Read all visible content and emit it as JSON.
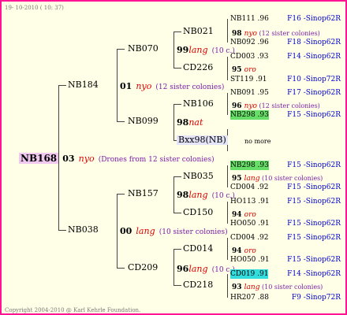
{
  "header": {
    "date": "19- 10-2010 ( 10: 37)"
  },
  "footer": {
    "copyright": "Copyright 2004-2010 @ Karl Kehrle Foundation."
  },
  "root": {
    "id": "NB168",
    "gen": "03",
    "mark": "nyo",
    "note": "(Drones from 12 sister colonies)"
  },
  "g1": {
    "top": "NB184",
    "bot": "NB038"
  },
  "g2a": {
    "num": "01",
    "mark": "nyo",
    "note": "(12 sister colonies)"
  },
  "g2b": {
    "num": "00",
    "mark": "lang",
    "note": "(10 sister colonies)"
  },
  "g3": {
    "nb070": "NB070",
    "nb099": "NB099",
    "nb157": "NB157",
    "cd209": "CD209"
  },
  "g3n": {
    "a": {
      "num": "99",
      "mark": "lang",
      "note": "(10 c.)"
    },
    "b": {
      "num": "98",
      "mark": "nat"
    },
    "c": {
      "num": "98",
      "mark": "lang",
      "note": "(10 c.)"
    },
    "d": {
      "num": "96",
      "mark": "lang",
      "note": "(10 c.)"
    }
  },
  "bxx": "Bxx98(NB)",
  "nomore": "no more",
  "g4": [
    "NB021",
    "CD226",
    "NB106",
    "NB035",
    "CD150",
    "CD014",
    "CD218"
  ],
  "rows": [
    {
      "name": "NB111 .96",
      "right": "F16 -Sinop62R"
    },
    {
      "num": "98",
      "mark": "nyo",
      "note": "(12 sister colonies)"
    },
    {
      "name": "NB092 .96",
      "right": "F18 -Sinop62R"
    },
    {
      "name": "CD003 .93",
      "right": "F14 -Sinop62R"
    },
    {
      "num": "95",
      "mark": "oro"
    },
    {
      "name": "ST119 .91",
      "right": "F10 -Sinop72R"
    },
    {
      "name": "NB091 .95",
      "right": "F17 -Sinop62R"
    },
    {
      "num": "96",
      "mark": "nyo",
      "note": "(12 sister colonies)"
    },
    {
      "name": "NB298 .93",
      "right": "F15 -Sinop62R"
    },
    {
      "name": "NB298 .93",
      "right": "F15 -Sinop62R"
    },
    {
      "num": "95",
      "mark": "lang",
      "note": "(10 sister colonies)"
    },
    {
      "name": "CD004 .92",
      "right": "F15 -Sinop62R"
    },
    {
      "name": "HO113 .91",
      "right": "F15 -Sinop62R"
    },
    {
      "num": "94",
      "mark": "oro"
    },
    {
      "name": "HO050 .91",
      "right": "F15 -Sinop62R"
    },
    {
      "name": "CD004 .92",
      "right": "F15 -Sinop62R"
    },
    {
      "num": "94",
      "mark": "oro"
    },
    {
      "name": "HO050 .91",
      "right": "F15 -Sinop62R"
    },
    {
      "name": "CD019 .91",
      "right": "F14 -Sinop62R"
    },
    {
      "num": "93",
      "mark": "lang",
      "note": "(10 sister colonies)"
    },
    {
      "name": "HR207 .88",
      "right": "F9 -Sinop72R"
    }
  ]
}
